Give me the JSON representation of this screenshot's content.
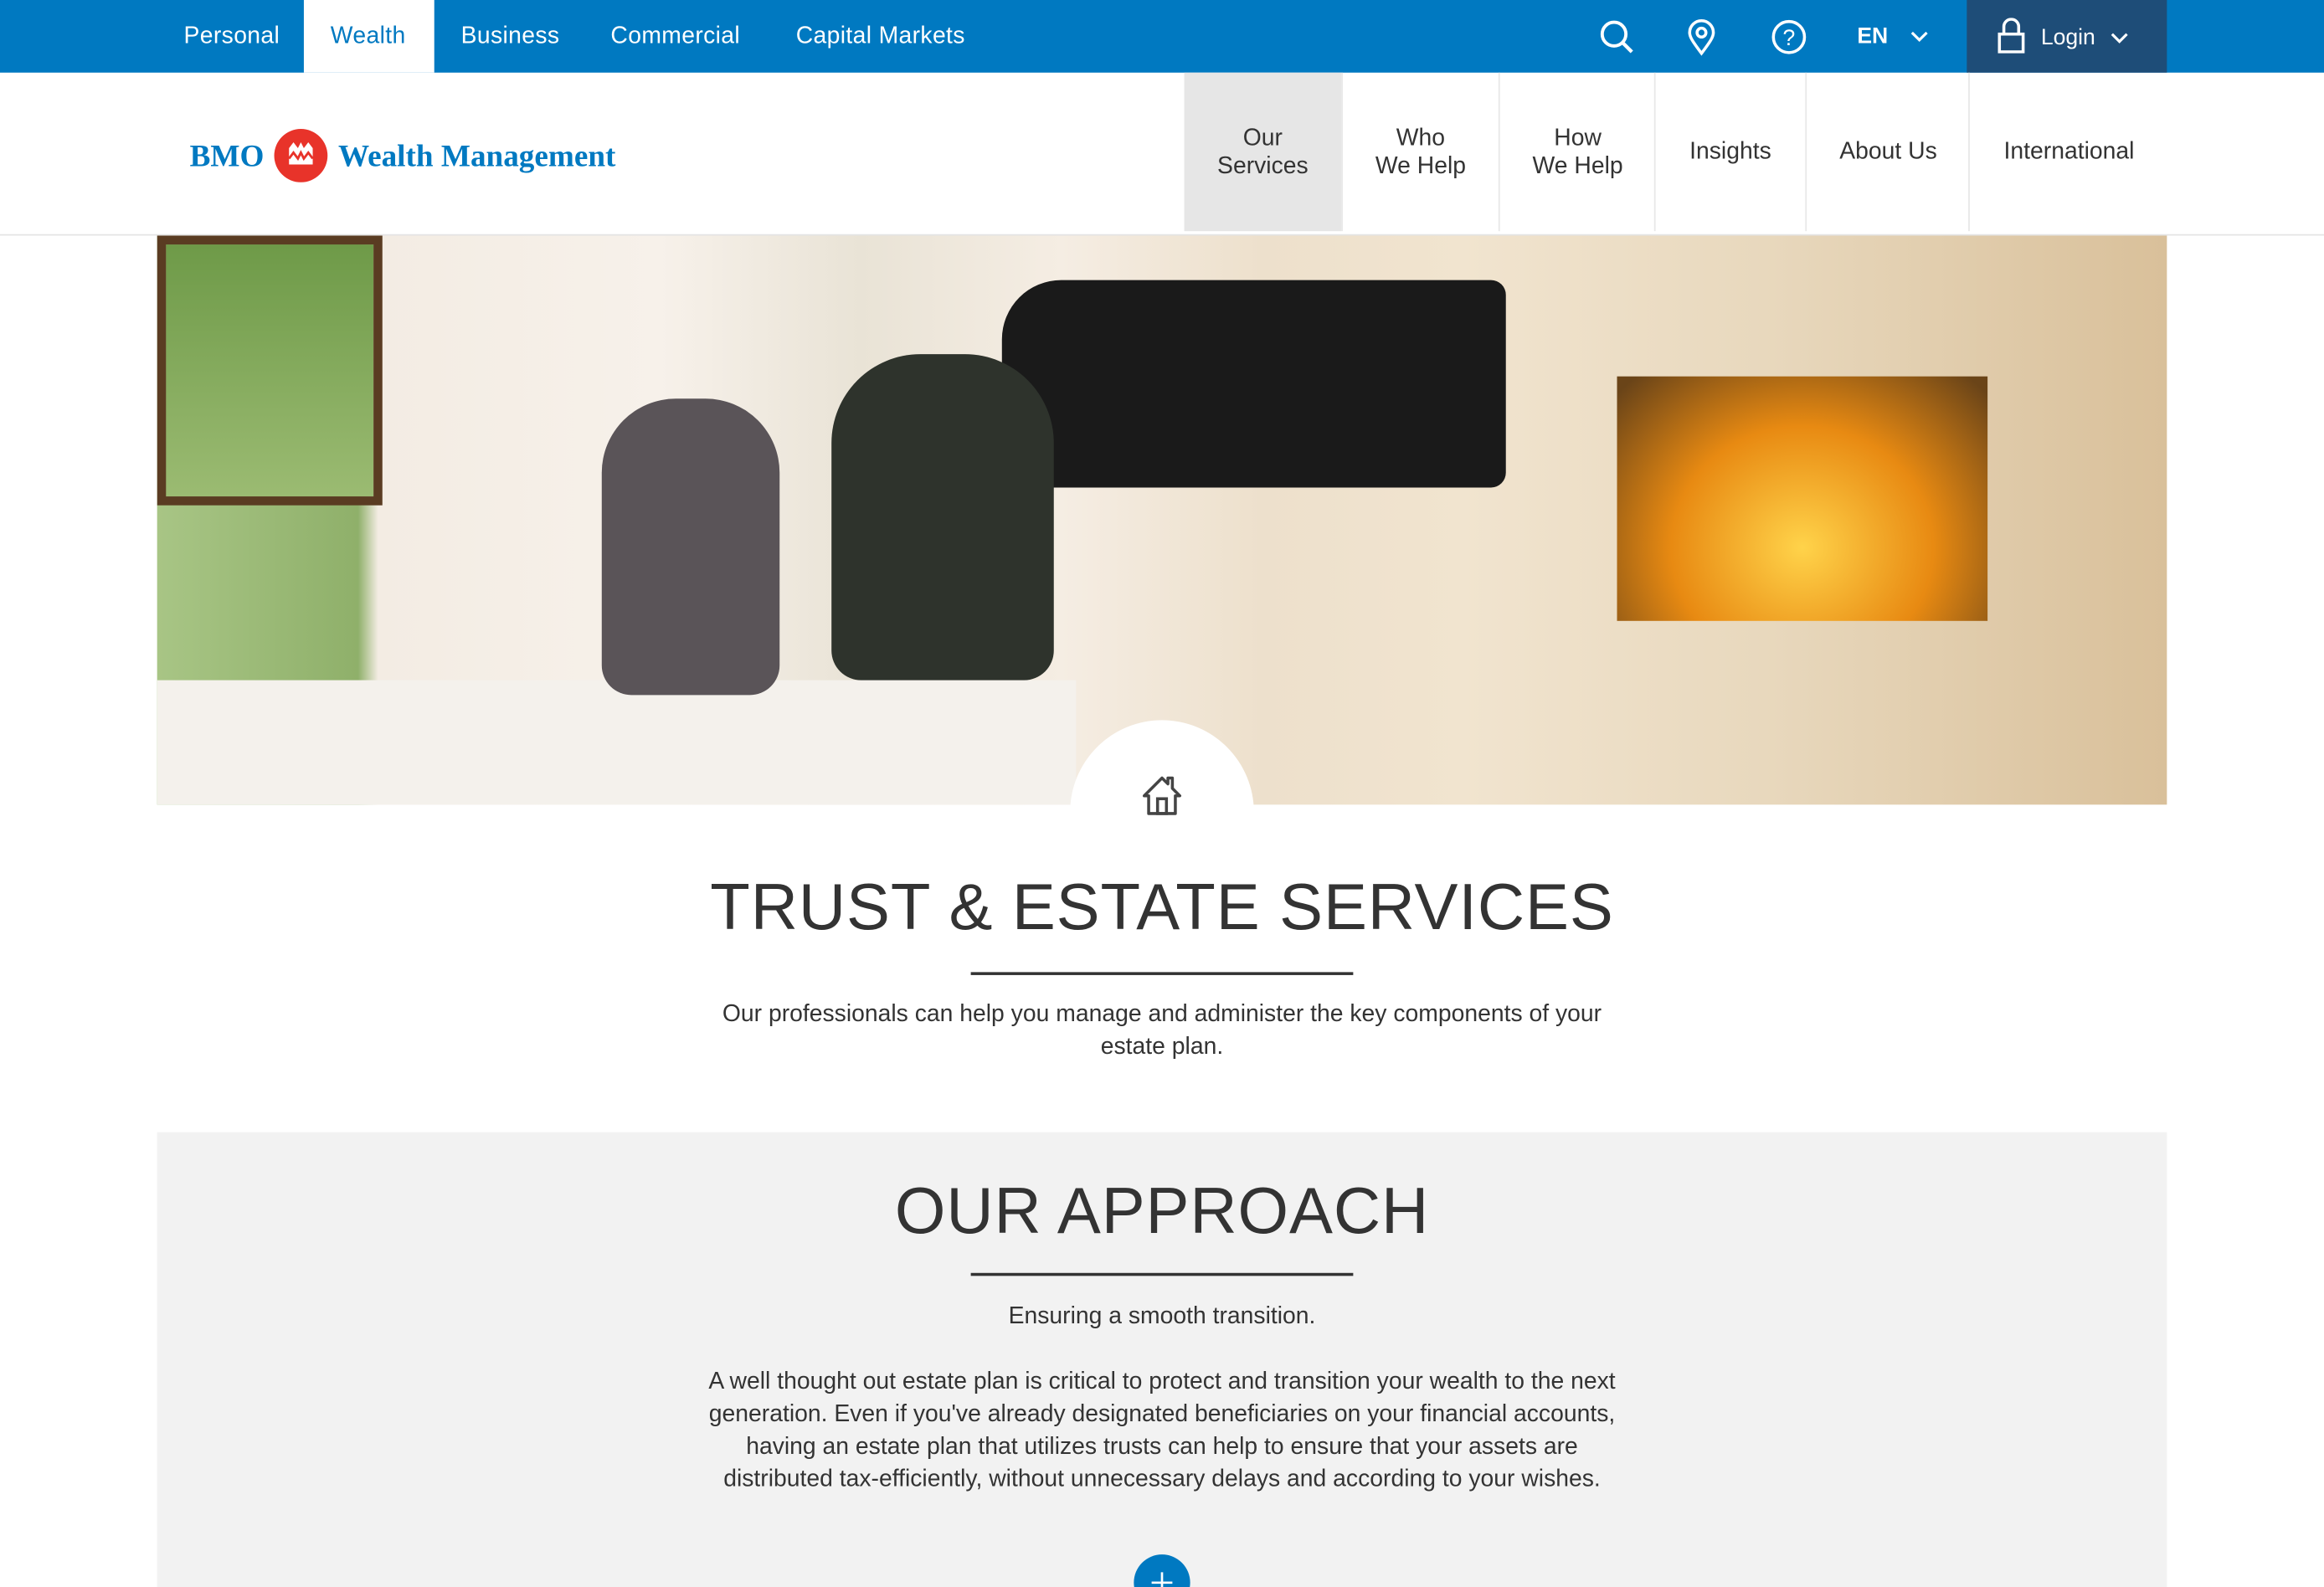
{
  "top_nav": {
    "segments": [
      "Personal",
      "Wealth",
      "Business",
      "Commercial",
      "Capital Markets"
    ],
    "active": "Wealth",
    "language": "EN",
    "login_label": "Login"
  },
  "logo": {
    "bmo": "BMO",
    "product": "Wealth Management"
  },
  "main_nav": [
    {
      "line1": "Our",
      "line2": "Services"
    },
    {
      "line1": "Who",
      "line2": "We Help"
    },
    {
      "line1": "How",
      "line2": "We Help"
    },
    {
      "line1": "Insights",
      "line2": ""
    },
    {
      "line1": "About Us",
      "line2": ""
    },
    {
      "line1": "International",
      "line2": ""
    }
  ],
  "hero": {
    "title": "TRUST & ESTATE SERVICES",
    "subtitle": "Our professionals can help you manage and administer the key components of your estate plan."
  },
  "approach": {
    "title": "OUR APPROACH",
    "tagline": "Ensuring a smooth transition.",
    "body": "A well thought out estate plan is critical to protect and transition your wealth to the next generation. Even if you've already designated beneficiaries on your financial accounts, having an estate plan that utilizes trusts can help to ensure that your assets are distributed tax-efficiently, without unnecessary delays and according to your wishes."
  },
  "colors": {
    "brand_blue": "#0079c1",
    "login_bg": "#1e4d78",
    "bmo_red": "#e8332a"
  }
}
